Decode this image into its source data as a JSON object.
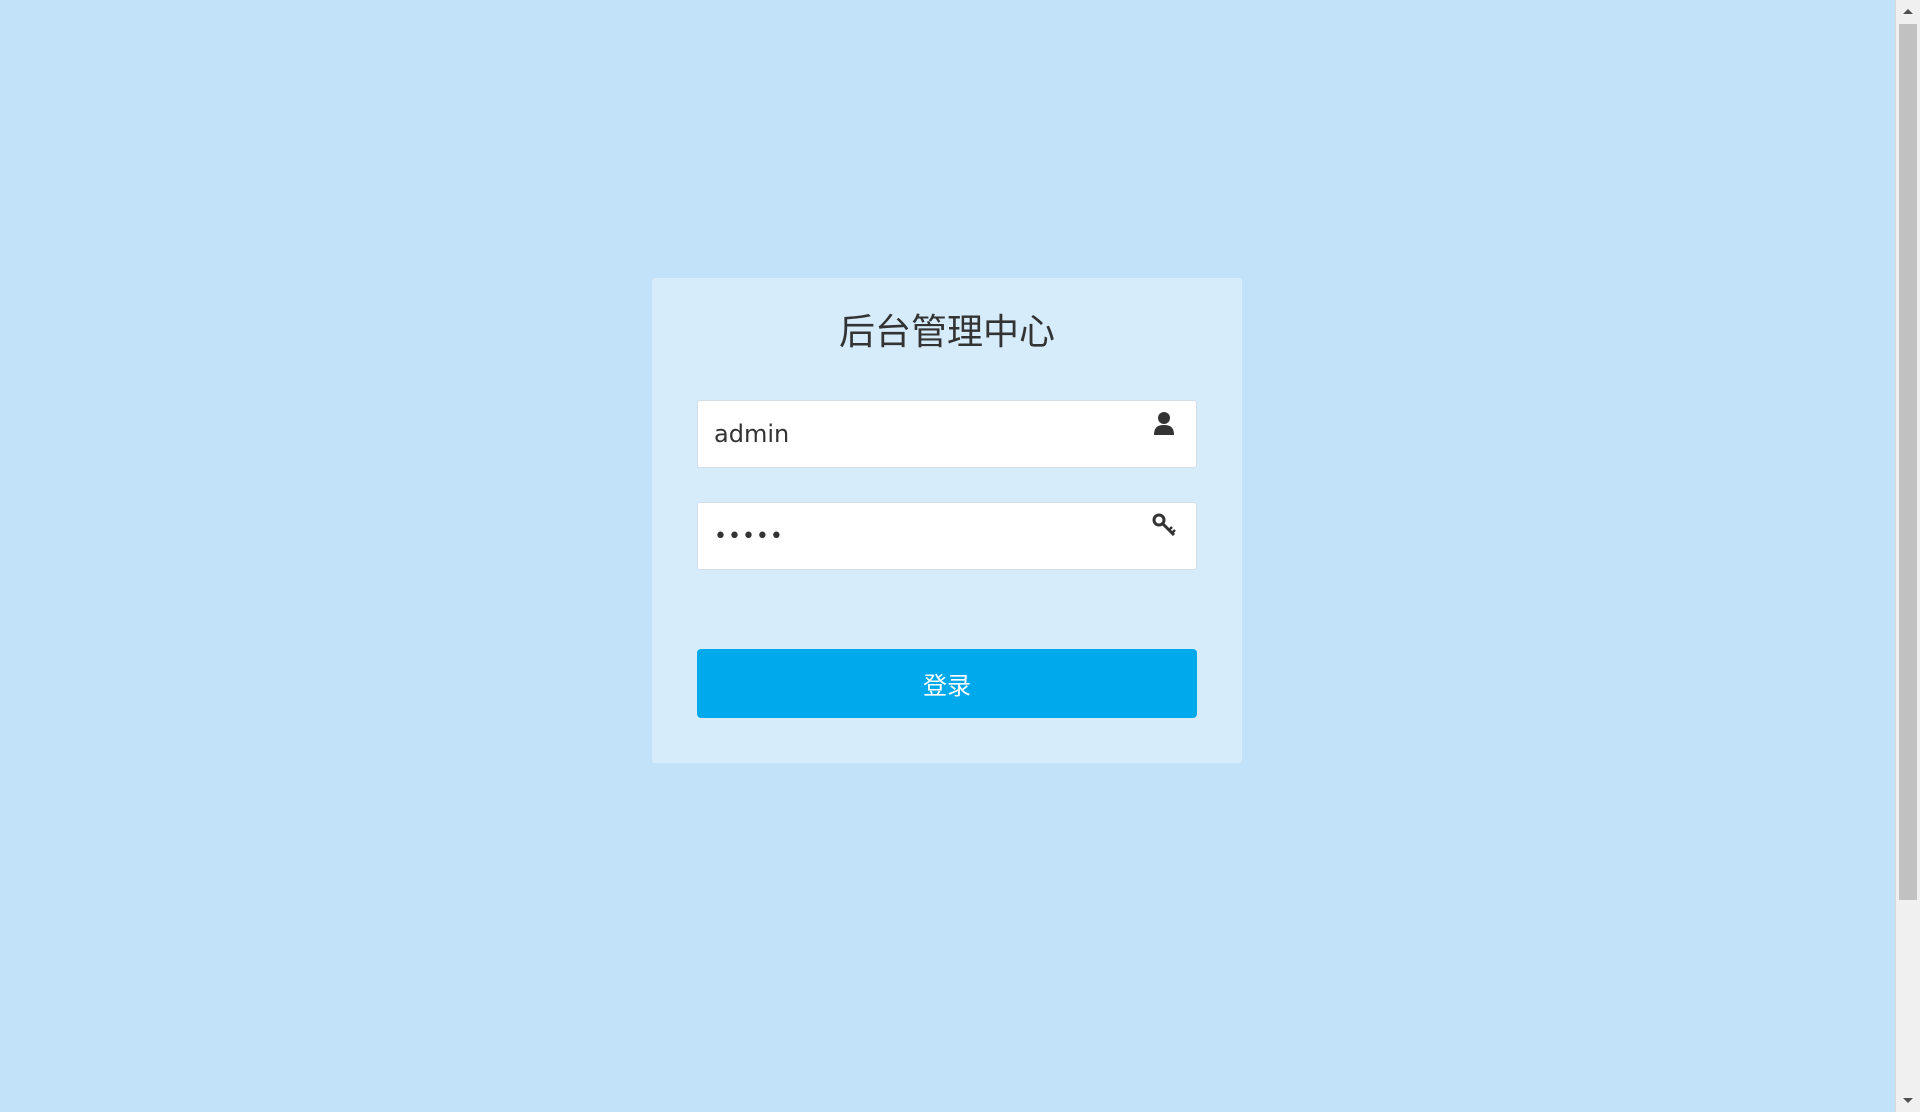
{
  "page": {
    "background_color": "#c1e2f8"
  },
  "login_card": {
    "title": "后台管理中心",
    "username": {
      "value": "admin",
      "icon": "user-icon"
    },
    "password": {
      "value": "•••••",
      "icon": "key-icon"
    },
    "submit_label": "登录",
    "button_color": "#00a8ec",
    "card_color": "#d6ecfb"
  },
  "scrollbar": {
    "up_icon": "scroll-up-arrow-icon",
    "down_icon": "scroll-down-arrow-icon"
  }
}
